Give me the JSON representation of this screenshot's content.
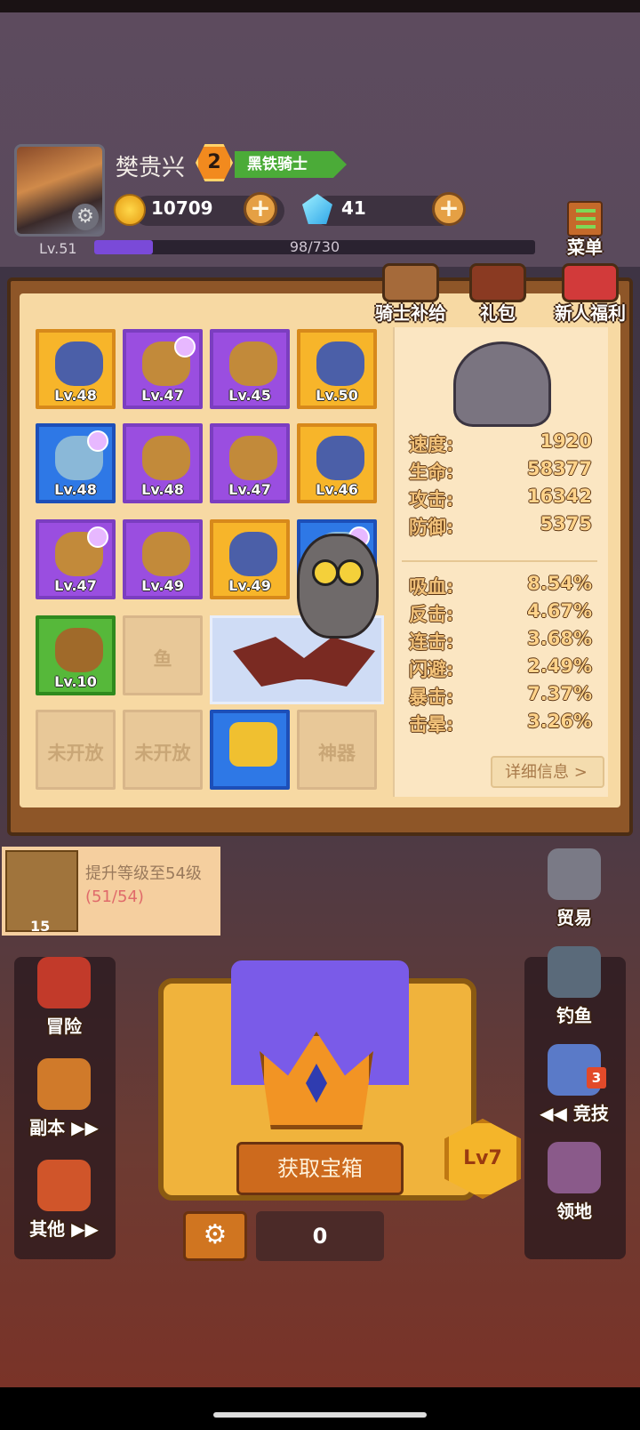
{
  "player": {
    "name": "樊贵兴",
    "rank": "2",
    "title": "黑铁骑士",
    "gold": "10709",
    "gems": "41",
    "level_label": "Lv.51",
    "xp_text": "98/730",
    "xp_fraction": 0.134
  },
  "top_menu": {
    "menu_label": "菜单",
    "knight_supply_label": "骑士补给",
    "gift_pack_label": "礼包",
    "newbie_bonus_label": "新人福利"
  },
  "equipment": {
    "rows": [
      [
        {
          "level": "Lv.48",
          "rarity": "orange",
          "swirl": false
        },
        {
          "level": "Lv.47",
          "rarity": "purple",
          "swirl": true
        },
        {
          "level": "Lv.45",
          "rarity": "purple",
          "swirl": false
        },
        {
          "level": "Lv.50",
          "rarity": "orange",
          "swirl": false
        }
      ],
      [
        {
          "level": "Lv.48",
          "rarity": "blue",
          "swirl": true
        },
        {
          "level": "Lv.48",
          "rarity": "purple",
          "swirl": false
        },
        {
          "level": "Lv.47",
          "rarity": "purple",
          "swirl": false
        },
        {
          "level": "Lv.46",
          "rarity": "orange",
          "swirl": false
        }
      ],
      [
        {
          "level": "Lv.47",
          "rarity": "purple",
          "swirl": true
        },
        {
          "level": "Lv.49",
          "rarity": "purple",
          "swirl": false
        },
        {
          "level": "Lv.49",
          "rarity": "orange",
          "swirl": false
        },
        {
          "level": "",
          "rarity": "blue",
          "swirl": true
        }
      ]
    ],
    "mount_level": "Lv.10",
    "fish_slot_label": "鱼",
    "locked_label_1": "未开放",
    "locked_label_2": "未开放",
    "artifact_label": "神器"
  },
  "stats": {
    "primary": [
      {
        "key": "速度:",
        "value": "1920"
      },
      {
        "key": "生命:",
        "value": "58377"
      },
      {
        "key": "攻击:",
        "value": "16342"
      },
      {
        "key": "防御:",
        "value": "5375"
      }
    ],
    "secondary": [
      {
        "key": "吸血:",
        "value": "8.54%"
      },
      {
        "key": "反击:",
        "value": "4.67%"
      },
      {
        "key": "连击:",
        "value": "3.68%"
      },
      {
        "key": "闪避:",
        "value": "2.49%"
      },
      {
        "key": "暴击:",
        "value": "7.37%"
      },
      {
        "key": "击晕:",
        "value": "3.26%"
      }
    ],
    "detail_label": "详细信息 >"
  },
  "quest": {
    "text": "提升等级至54级",
    "progress": "(51/54)",
    "count": "15"
  },
  "left_menu": [
    {
      "label": "冒险",
      "icon": "adventure-flag-icon"
    },
    {
      "label": "副本 ▶▶",
      "icon": "dungeon-shield-icon"
    },
    {
      "label": "其他 ▶▶",
      "icon": "other-house-icon"
    }
  ],
  "right_menu": [
    {
      "label": "贸易",
      "icon": "trade-ship-icon"
    },
    {
      "label": "钓鱼",
      "icon": "fishing-icon"
    },
    {
      "label": "◀◀ 竞技",
      "icon": "arena-swords-icon",
      "badge": "3"
    },
    {
      "label": "领地",
      "icon": "territory-icon"
    }
  ],
  "chest": {
    "get_label": "获取宝箱",
    "level_label": "Lv7",
    "count": "0"
  },
  "colors": {
    "accent_orange": "#cd6a1d",
    "purple_rarity": "#9a4ee0",
    "orange_rarity": "#f7b52a",
    "blue_rarity": "#2e78e6",
    "green_rarity": "#56b83a"
  }
}
